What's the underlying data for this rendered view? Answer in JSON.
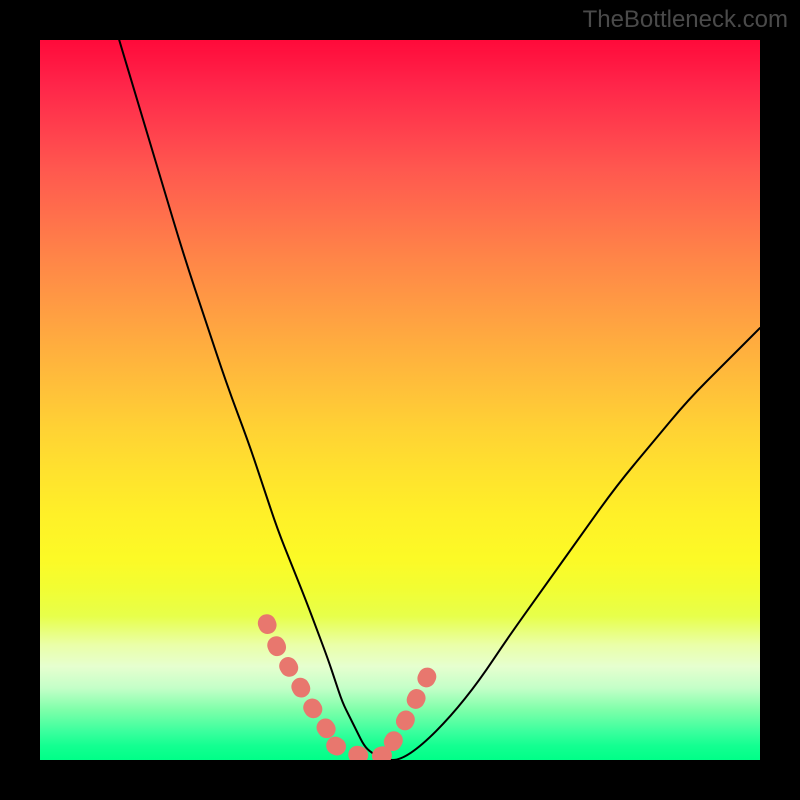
{
  "watermark": "TheBottleneck.com",
  "chart_data": {
    "type": "line",
    "title": "",
    "xlabel": "",
    "ylabel": "",
    "xlim": [
      0,
      100
    ],
    "ylim": [
      0,
      100
    ],
    "series": [
      {
        "name": "bottleneck-curve",
        "x": [
          11,
          14,
          17,
          20,
          23,
          26,
          29,
          31,
          33,
          35,
          37,
          38.5,
          40,
          41,
          42,
          43,
          44,
          45,
          46,
          48,
          50,
          53,
          57,
          61,
          65,
          70,
          75,
          80,
          85,
          90,
          95,
          100
        ],
        "y": [
          100,
          90,
          80,
          70,
          61,
          52,
          44,
          38,
          32,
          27,
          22,
          18,
          14,
          11,
          8,
          6,
          4,
          2,
          1,
          0,
          0,
          2,
          6,
          11,
          17,
          24,
          31,
          38,
          44,
          50,
          55,
          60
        ]
      }
    ],
    "markers": [
      {
        "name": "highlight-segment-left",
        "color": "#e8776e",
        "x": [
          31.5,
          33,
          34.5,
          36,
          37,
          38,
          39,
          40,
          41
        ],
        "y": [
          19,
          15.5,
          13,
          10.5,
          8.5,
          7,
          5.5,
          4,
          3
        ]
      },
      {
        "name": "highlight-segment-bottom",
        "color": "#e8776e",
        "x": [
          41,
          43,
          45,
          47,
          49
        ],
        "y": [
          2,
          1,
          0.5,
          0.5,
          1
        ]
      },
      {
        "name": "highlight-segment-right",
        "color": "#e8776e",
        "x": [
          49,
          50.5,
          52,
          53.5,
          55
        ],
        "y": [
          2.5,
          5,
          8,
          11,
          14
        ]
      }
    ],
    "gradient_stops": [
      {
        "offset": 0,
        "color": "#ff0a3a"
      },
      {
        "offset": 50,
        "color": "#ffd234"
      },
      {
        "offset": 80,
        "color": "#ecff60"
      },
      {
        "offset": 100,
        "color": "#00ff88"
      }
    ]
  }
}
